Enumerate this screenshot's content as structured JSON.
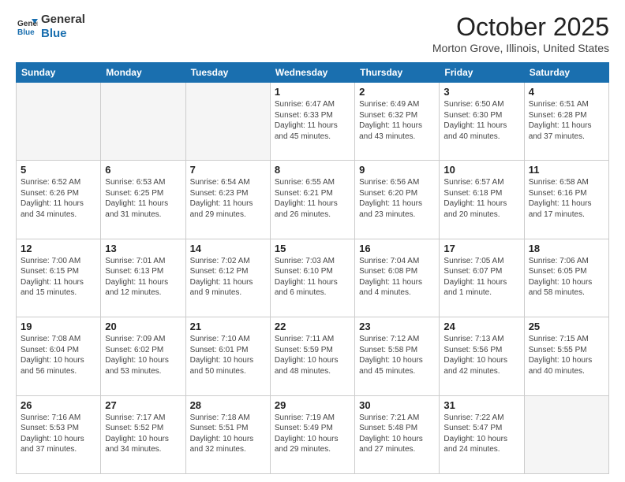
{
  "header": {
    "logo_line1": "General",
    "logo_line2": "Blue",
    "month": "October 2025",
    "location": "Morton Grove, Illinois, United States"
  },
  "days_of_week": [
    "Sunday",
    "Monday",
    "Tuesday",
    "Wednesday",
    "Thursday",
    "Friday",
    "Saturday"
  ],
  "weeks": [
    [
      {
        "day": "",
        "info": ""
      },
      {
        "day": "",
        "info": ""
      },
      {
        "day": "",
        "info": ""
      },
      {
        "day": "1",
        "info": "Sunrise: 6:47 AM\nSunset: 6:33 PM\nDaylight: 11 hours\nand 45 minutes."
      },
      {
        "day": "2",
        "info": "Sunrise: 6:49 AM\nSunset: 6:32 PM\nDaylight: 11 hours\nand 43 minutes."
      },
      {
        "day": "3",
        "info": "Sunrise: 6:50 AM\nSunset: 6:30 PM\nDaylight: 11 hours\nand 40 minutes."
      },
      {
        "day": "4",
        "info": "Sunrise: 6:51 AM\nSunset: 6:28 PM\nDaylight: 11 hours\nand 37 minutes."
      }
    ],
    [
      {
        "day": "5",
        "info": "Sunrise: 6:52 AM\nSunset: 6:26 PM\nDaylight: 11 hours\nand 34 minutes."
      },
      {
        "day": "6",
        "info": "Sunrise: 6:53 AM\nSunset: 6:25 PM\nDaylight: 11 hours\nand 31 minutes."
      },
      {
        "day": "7",
        "info": "Sunrise: 6:54 AM\nSunset: 6:23 PM\nDaylight: 11 hours\nand 29 minutes."
      },
      {
        "day": "8",
        "info": "Sunrise: 6:55 AM\nSunset: 6:21 PM\nDaylight: 11 hours\nand 26 minutes."
      },
      {
        "day": "9",
        "info": "Sunrise: 6:56 AM\nSunset: 6:20 PM\nDaylight: 11 hours\nand 23 minutes."
      },
      {
        "day": "10",
        "info": "Sunrise: 6:57 AM\nSunset: 6:18 PM\nDaylight: 11 hours\nand 20 minutes."
      },
      {
        "day": "11",
        "info": "Sunrise: 6:58 AM\nSunset: 6:16 PM\nDaylight: 11 hours\nand 17 minutes."
      }
    ],
    [
      {
        "day": "12",
        "info": "Sunrise: 7:00 AM\nSunset: 6:15 PM\nDaylight: 11 hours\nand 15 minutes."
      },
      {
        "day": "13",
        "info": "Sunrise: 7:01 AM\nSunset: 6:13 PM\nDaylight: 11 hours\nand 12 minutes."
      },
      {
        "day": "14",
        "info": "Sunrise: 7:02 AM\nSunset: 6:12 PM\nDaylight: 11 hours\nand 9 minutes."
      },
      {
        "day": "15",
        "info": "Sunrise: 7:03 AM\nSunset: 6:10 PM\nDaylight: 11 hours\nand 6 minutes."
      },
      {
        "day": "16",
        "info": "Sunrise: 7:04 AM\nSunset: 6:08 PM\nDaylight: 11 hours\nand 4 minutes."
      },
      {
        "day": "17",
        "info": "Sunrise: 7:05 AM\nSunset: 6:07 PM\nDaylight: 11 hours\nand 1 minute."
      },
      {
        "day": "18",
        "info": "Sunrise: 7:06 AM\nSunset: 6:05 PM\nDaylight: 10 hours\nand 58 minutes."
      }
    ],
    [
      {
        "day": "19",
        "info": "Sunrise: 7:08 AM\nSunset: 6:04 PM\nDaylight: 10 hours\nand 56 minutes."
      },
      {
        "day": "20",
        "info": "Sunrise: 7:09 AM\nSunset: 6:02 PM\nDaylight: 10 hours\nand 53 minutes."
      },
      {
        "day": "21",
        "info": "Sunrise: 7:10 AM\nSunset: 6:01 PM\nDaylight: 10 hours\nand 50 minutes."
      },
      {
        "day": "22",
        "info": "Sunrise: 7:11 AM\nSunset: 5:59 PM\nDaylight: 10 hours\nand 48 minutes."
      },
      {
        "day": "23",
        "info": "Sunrise: 7:12 AM\nSunset: 5:58 PM\nDaylight: 10 hours\nand 45 minutes."
      },
      {
        "day": "24",
        "info": "Sunrise: 7:13 AM\nSunset: 5:56 PM\nDaylight: 10 hours\nand 42 minutes."
      },
      {
        "day": "25",
        "info": "Sunrise: 7:15 AM\nSunset: 5:55 PM\nDaylight: 10 hours\nand 40 minutes."
      }
    ],
    [
      {
        "day": "26",
        "info": "Sunrise: 7:16 AM\nSunset: 5:53 PM\nDaylight: 10 hours\nand 37 minutes."
      },
      {
        "day": "27",
        "info": "Sunrise: 7:17 AM\nSunset: 5:52 PM\nDaylight: 10 hours\nand 34 minutes."
      },
      {
        "day": "28",
        "info": "Sunrise: 7:18 AM\nSunset: 5:51 PM\nDaylight: 10 hours\nand 32 minutes."
      },
      {
        "day": "29",
        "info": "Sunrise: 7:19 AM\nSunset: 5:49 PM\nDaylight: 10 hours\nand 29 minutes."
      },
      {
        "day": "30",
        "info": "Sunrise: 7:21 AM\nSunset: 5:48 PM\nDaylight: 10 hours\nand 27 minutes."
      },
      {
        "day": "31",
        "info": "Sunrise: 7:22 AM\nSunset: 5:47 PM\nDaylight: 10 hours\nand 24 minutes."
      },
      {
        "day": "",
        "info": ""
      }
    ]
  ]
}
